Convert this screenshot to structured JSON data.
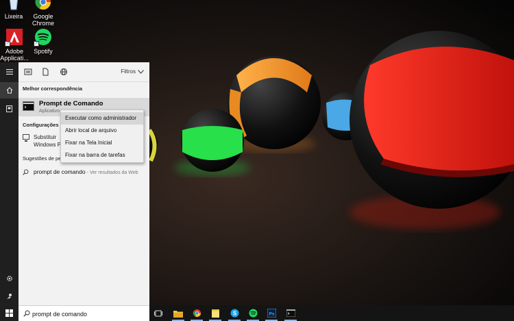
{
  "desktop": {
    "icons": [
      {
        "label": "Lixeira",
        "icon": "recycle-bin-icon"
      },
      {
        "label": "Google Chrome",
        "icon": "chrome-icon"
      },
      {
        "label": "Adobe Applicati...",
        "icon": "adobe-icon"
      },
      {
        "label": "Spotify",
        "icon": "spotify-icon"
      }
    ]
  },
  "rail": {
    "items": [
      "hamburger-menu-icon",
      "home-icon",
      "notebook-icon",
      "settings-icon",
      "feedback-icon",
      "windows-start-icon"
    ]
  },
  "panel": {
    "top": {
      "filter_icons": [
        "apps-filter-icon",
        "documents-filter-icon",
        "web-filter-icon"
      ],
      "filters_label": "Filtros"
    },
    "best_match": {
      "heading": "Melhor correspondência",
      "title": "Prompt de Comando",
      "subtitle": "Aplicativo"
    },
    "settings": {
      "heading": "Configurações",
      "item_line1": "Substituir",
      "item_line2": "Windows P"
    },
    "suggestions": {
      "heading": "Sugestões de pe",
      "query": "prompt de comando",
      "web_hint": " - Ver resultados da Web"
    }
  },
  "context_menu": {
    "items": [
      "Executar como administrador",
      "Abrir local de arquivo",
      "Fixar na Tela Inicial",
      "Fixar na barra de tarefas"
    ]
  },
  "search": {
    "value": "prompt de comando"
  },
  "taskbar": {
    "items": [
      "task-view-icon",
      "file-explorer-icon",
      "chrome-icon",
      "sticky-notes-icon",
      "skype-icon",
      "spotify-icon",
      "photoshop-icon",
      "command-prompt-icon"
    ]
  },
  "colors": {
    "rail": "#1f1f1f",
    "panel": "#f2f2f2",
    "taskbar": "#141414",
    "selection": "#d9d9d9"
  }
}
